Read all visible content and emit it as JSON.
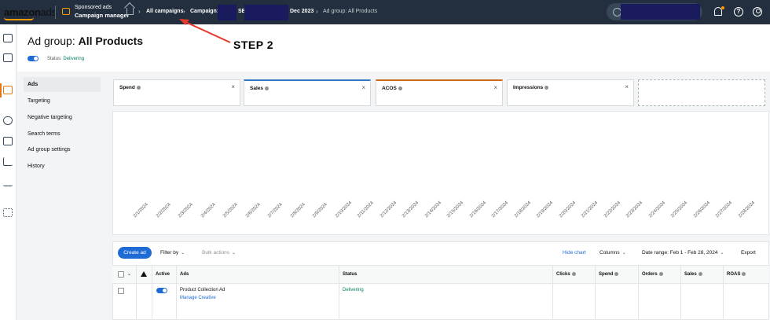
{
  "topbar": {
    "logo_main": "amazon",
    "logo_suffix": "ads",
    "product_sub": "Sponsored ads",
    "product_title": "Campaign manager",
    "breadcrumb": {
      "item1": "All campaigns",
      "item2_prefix": "Campaign:",
      "item2_part": "SB",
      "item2_suffix": "Dec 2023",
      "item3": "Ad group: All Products"
    },
    "help_glyph": "?"
  },
  "annotation": {
    "label": "STEP 2",
    "color": "#e8392c"
  },
  "page": {
    "title_prefix": "Ad group:",
    "title_name": "All Products",
    "status_prefix": "Status:",
    "status_value": "Delivering"
  },
  "subnav": {
    "items": [
      {
        "label": "Ads"
      },
      {
        "label": "Targeting"
      },
      {
        "label": "Negative targeting"
      },
      {
        "label": "Search terms"
      },
      {
        "label": "Ad group settings"
      },
      {
        "label": "History"
      }
    ]
  },
  "metrics": [
    {
      "label": "Spend",
      "accent": "#d5d9d9"
    },
    {
      "label": "Sales",
      "accent": "#2f7ac1"
    },
    {
      "label": "ACOS",
      "accent": "#c86a1a"
    },
    {
      "label": "Impressions",
      "accent": "#d5d9d9"
    }
  ],
  "metric_close_glyph": "×",
  "chart_data": {
    "type": "line",
    "x": [
      "2/1/2024",
      "2/2/2024",
      "2/3/2024",
      "2/4/2024",
      "2/5/2024",
      "2/6/2024",
      "2/7/2024",
      "2/8/2024",
      "2/9/2024",
      "2/10/2024",
      "2/11/2024",
      "2/12/2024",
      "2/13/2024",
      "2/14/2024",
      "2/15/2024",
      "2/16/2024",
      "2/17/2024",
      "2/18/2024",
      "2/19/2024",
      "2/20/2024",
      "2/21/2024",
      "2/22/2024",
      "2/23/2024",
      "2/24/2024",
      "2/25/2024",
      "2/26/2024",
      "2/27/2024",
      "2/28/2024"
    ],
    "series": [],
    "grid": false
  },
  "toolbar": {
    "create_label": "Create ad",
    "filter_label": "Filter by",
    "bulk_label": "Bulk actions",
    "hide_chart_label": "Hide chart",
    "columns_label": "Columns",
    "date_range_label": "Date range: Feb 1 - Feb 28, 2024",
    "export_label": "Export"
  },
  "table": {
    "headers": {
      "active": "Active",
      "ads": "Ads",
      "status": "Status",
      "clicks": "Clicks",
      "spend": "Spend",
      "orders": "Orders",
      "sales": "Sales",
      "roas": "ROAS"
    },
    "rows": [
      {
        "ad_name": "Product Collection Ad",
        "ad_link": "Manage Creative",
        "status": "Delivering"
      }
    ]
  },
  "caret_glyph": "⌄"
}
